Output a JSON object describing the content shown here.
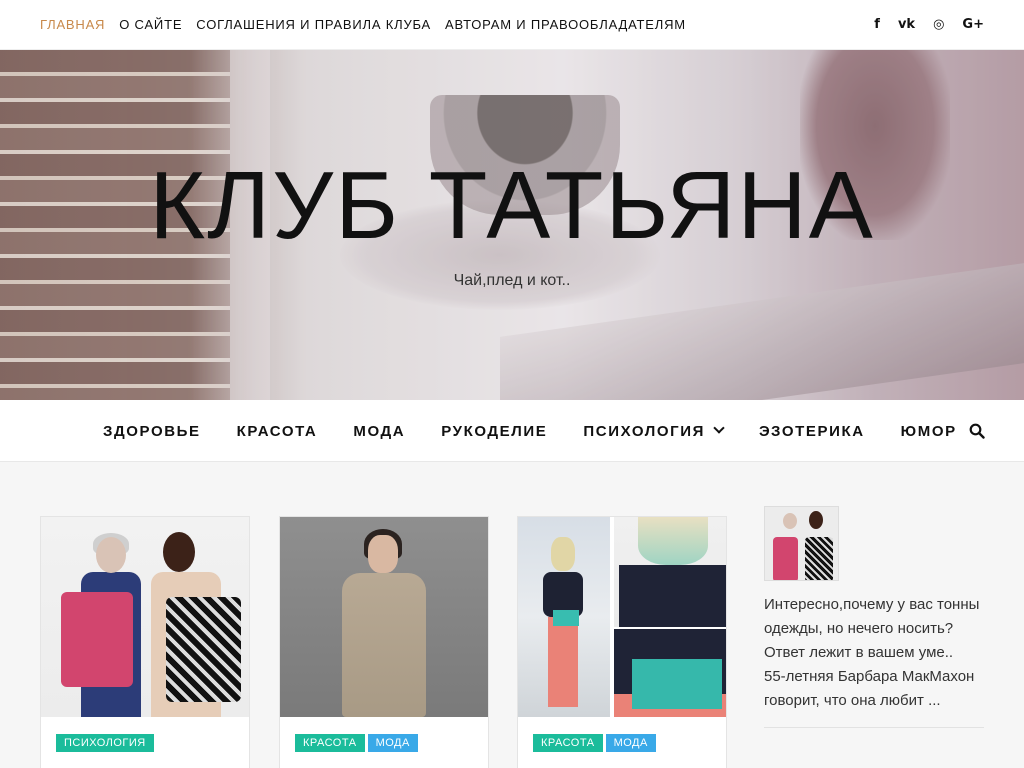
{
  "top_menu": {
    "items": [
      {
        "label": "Главная",
        "active": true
      },
      {
        "label": "О сайте",
        "active": false
      },
      {
        "label": "Соглашения и правила клуба",
        "active": false
      },
      {
        "label": "Авторам и правообладателям",
        "active": false
      }
    ],
    "active_color": "#c8894a"
  },
  "social_icons": [
    {
      "name": "facebook-icon",
      "glyph": "f"
    },
    {
      "name": "vk-icon",
      "glyph": "vk"
    },
    {
      "name": "instagram-icon",
      "glyph": "◎"
    },
    {
      "name": "google-plus-icon",
      "glyph": "G+"
    }
  ],
  "header": {
    "site_title": "КЛУБ ТАТЬЯНА",
    "tagline": "Чай,плед и кот.."
  },
  "main_nav": {
    "items": [
      {
        "label": "Здоровье"
      },
      {
        "label": "Красота"
      },
      {
        "label": "Мода"
      },
      {
        "label": "Рукоделие"
      },
      {
        "label": "Психология",
        "has_dropdown": true
      },
      {
        "label": "Эзотерика"
      },
      {
        "label": "Юмор"
      }
    ],
    "search_icon": "search-icon"
  },
  "posts": [
    {
      "tags": [
        {
          "label": "Психология",
          "color": "#1bbc9b"
        }
      ]
    },
    {
      "tags": [
        {
          "label": "Красота",
          "color": "#1bbc9b"
        },
        {
          "label": "Мода",
          "color": "#39a9e8"
        }
      ]
    },
    {
      "tags": [
        {
          "label": "Красота",
          "color": "#1bbc9b"
        },
        {
          "label": "Мода",
          "color": "#39a9e8"
        }
      ]
    }
  ],
  "sidebar": {
    "post": {
      "title": "Интересно,почему у вас тонны одежды, но нечего носить? Ответ лежит в вашем уме..",
      "excerpt": "55-летняя Барбара МакМахон говорит, что она любит ..."
    }
  }
}
